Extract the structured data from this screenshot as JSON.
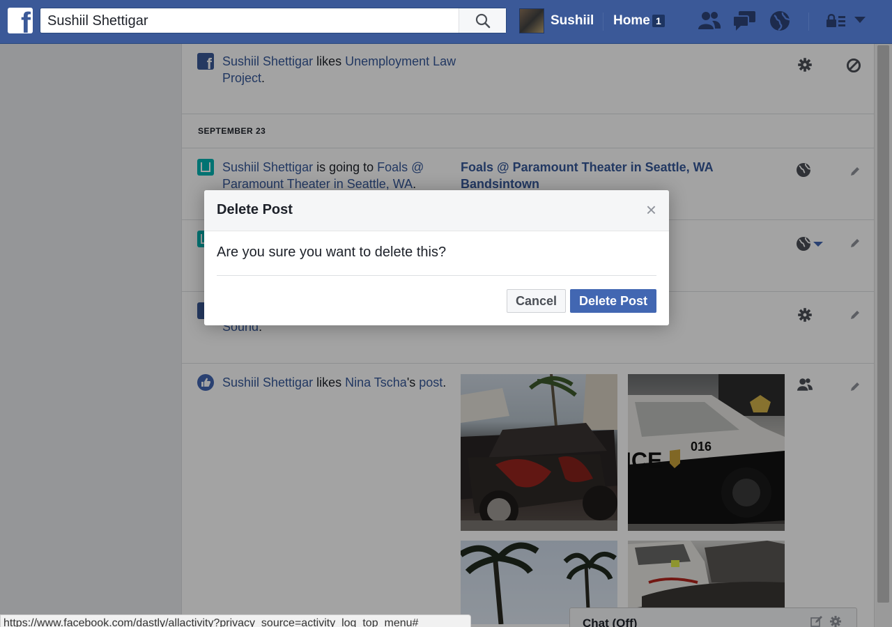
{
  "search": {
    "value": "Sushiil Shettigar"
  },
  "nav": {
    "user_name": "Sushiil",
    "home_label": "Home",
    "home_count": "1"
  },
  "feed": {
    "row1": {
      "actor": "Sushiil Shettigar",
      "verb": " likes ",
      "object": "Unemployment Law Project",
      "tail": "."
    },
    "date_header": "SEPTEMBER 23",
    "row2": {
      "actor": "Sushiil Shettigar",
      "verb": " is going to ",
      "object": "Foals @ Paramount Theater in Seattle, WA",
      "tail": ".",
      "right_title": "Foals @ Paramount Theater in Seattle, WA",
      "right_subtitle": "Bandsintown"
    },
    "row4": {
      "partial_text": "Sound",
      "tail": "."
    },
    "row5": {
      "actor": "Sushiil Shettigar",
      "verb": " likes ",
      "object": "Nina Tscha",
      "possessive": "'s ",
      "post_link": "post",
      "tail": "."
    }
  },
  "modal": {
    "title": "Delete Post",
    "close": "×",
    "message": "Are you sure you want to delete this?",
    "cancel_label": "Cancel",
    "confirm_label": "Delete Post"
  },
  "status_url": "https://www.facebook.com/dastly/allactivity?privacy_source=activity_log_top_menu#",
  "chat": {
    "label": "Chat (Off)"
  },
  "colors": {
    "brand": "#3b5998",
    "link": "#365899",
    "primary_button": "#4267b2"
  }
}
